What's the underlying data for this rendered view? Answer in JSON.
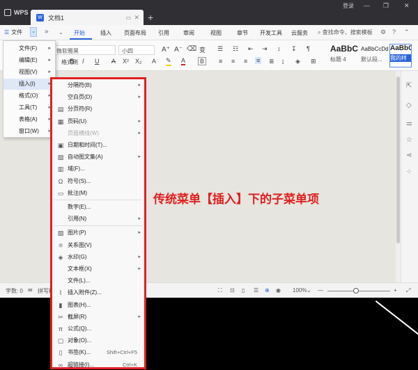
{
  "titlebar": {
    "app": "WPS",
    "doc_tab": "文档1",
    "add_tab": "+",
    "login": "登录",
    "minimize": "—",
    "restore": "❐",
    "close": "✕"
  },
  "menubar": {
    "file": "文件",
    "more": "»",
    "tabs": [
      "开始",
      "插入",
      "页面布局",
      "引用",
      "审阅",
      "视图",
      "章节",
      "开发工具",
      "云服务"
    ],
    "active_tab": "开始",
    "search": "查找命令、搜索模板"
  },
  "ribbon": {
    "font_name": "微软雅黑",
    "font_size": "小四",
    "format_painter": "格式刷",
    "styles": [
      {
        "sample": "AaBbC",
        "caption": "标题 4"
      },
      {
        "sample": "AaBbCcDd",
        "caption": "默认段..."
      },
      {
        "sample": "AaBbC",
        "caption": "我的样"
      }
    ]
  },
  "main_menu": {
    "items": [
      {
        "label": "文件(F)"
      },
      {
        "label": "编辑(E)"
      },
      {
        "label": "视图(V)"
      },
      {
        "label": "插入(I)"
      },
      {
        "label": "格式(O)"
      },
      {
        "label": "工具(T)"
      },
      {
        "label": "表格(A)"
      },
      {
        "label": "窗口(W)"
      }
    ],
    "highlighted": "插入(I)"
  },
  "submenu": {
    "items": [
      {
        "label": "分隔符(B)",
        "icon": "",
        "arrow": true
      },
      {
        "label": "空白页(D)",
        "icon": "",
        "arrow": true
      },
      {
        "label": "分页符(R)",
        "icon": "page-break-icon",
        "arrow": false
      },
      {
        "label": "页码(U)",
        "icon": "page-number-icon",
        "arrow": true
      },
      {
        "label": "页眉横线(W)",
        "icon": "",
        "arrow": true,
        "disabled": true
      },
      {
        "label": "日期和时间(T)...",
        "icon": "calendar-icon",
        "arrow": false
      },
      {
        "label": "自动图文集(A)",
        "icon": "autotext-icon",
        "arrow": true
      },
      {
        "label": "域(F)...",
        "icon": "field-icon",
        "arrow": false
      },
      {
        "label": "符号(S)...",
        "icon": "omega-icon",
        "arrow": false
      },
      {
        "label": "批注(M)",
        "icon": "comment-icon",
        "arrow": false
      },
      {
        "label": "数字(E)...",
        "icon": "",
        "arrow": false
      },
      {
        "label": "引用(N)",
        "icon": "",
        "arrow": true
      },
      {
        "label": "图片(P)",
        "icon": "image-icon",
        "arrow": true
      },
      {
        "label": "关系图(V)",
        "icon": "diagram-icon",
        "arrow": false
      },
      {
        "label": "水印(G)",
        "icon": "watermark-icon",
        "arrow": true
      },
      {
        "label": "文本框(X)",
        "icon": "",
        "arrow": true
      },
      {
        "label": "文件(L)...",
        "icon": "",
        "arrow": false
      },
      {
        "label": "插入附件(Z)...",
        "icon": "paperclip-icon",
        "arrow": false
      },
      {
        "label": "图表(H)...",
        "icon": "chart-icon",
        "arrow": false
      },
      {
        "label": "截屏(R)",
        "icon": "scissors-icon",
        "arrow": true
      },
      {
        "label": "公式(Q)...",
        "icon": "pi-icon",
        "arrow": false
      },
      {
        "label": "对象(O)...",
        "icon": "object-icon",
        "arrow": false
      },
      {
        "label": "书签(K)...",
        "icon": "bookmark-icon",
        "arrow": false,
        "shortcut": "Shift+Ctrl+F5"
      },
      {
        "label": "超链接(I)...",
        "icon": "link-icon",
        "arrow": false,
        "shortcut": "Ctrl+K"
      }
    ]
  },
  "annotation": "传统菜单【插入】下的子菜单项",
  "statusbar": {
    "word_count": "字数: 0",
    "spell": "拼写检",
    "zoom": "100%",
    "zoom_minus": "—",
    "zoom_plus": "+",
    "zoom_fraction": 0.45
  },
  "colors": {
    "accent": "#2b63d9",
    "highlight_box": "#e02020",
    "titlebar": "#2f2f34"
  }
}
